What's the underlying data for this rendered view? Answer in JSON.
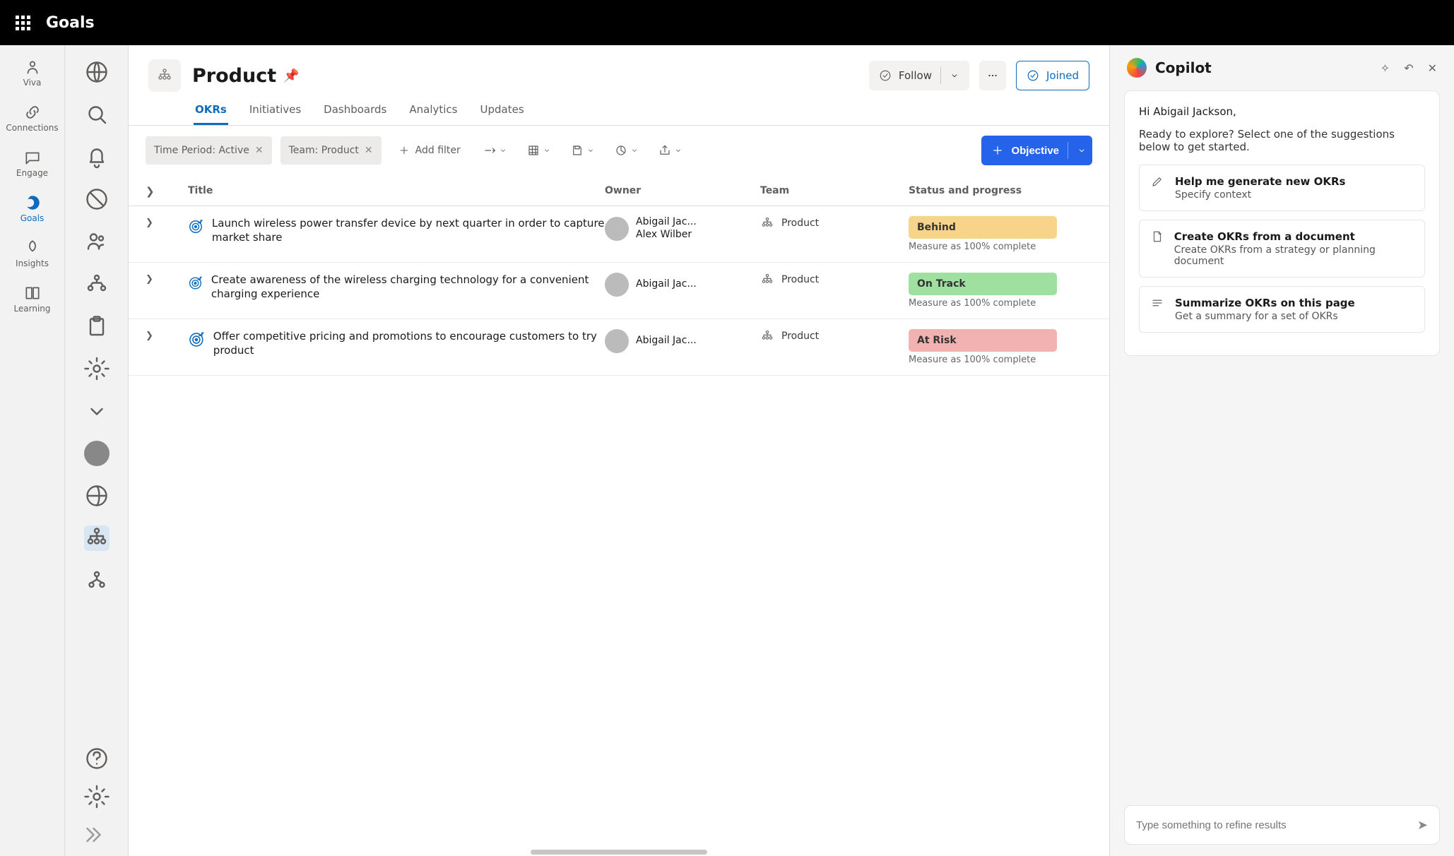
{
  "topbar": {
    "title": "Goals"
  },
  "appRail": [
    {
      "id": "viva",
      "label": "Viva"
    },
    {
      "id": "connections",
      "label": "Connections"
    },
    {
      "id": "engage",
      "label": "Engage"
    },
    {
      "id": "goals",
      "label": "Goals",
      "active": true
    },
    {
      "id": "insights",
      "label": "Insights"
    },
    {
      "id": "learning",
      "label": "Learning"
    }
  ],
  "page": {
    "title": "Product",
    "tabs": [
      "OKRs",
      "Initiatives",
      "Dashboards",
      "Analytics",
      "Updates"
    ],
    "follow": "Follow",
    "joined": "Joined"
  },
  "filters": {
    "timePeriod": "Time Period: Active",
    "team": "Team:  Product",
    "addFilter": "Add filter",
    "objectiveBtn": "Objective"
  },
  "columns": {
    "title": "Title",
    "owner": "Owner",
    "team": "Team",
    "status": "Status and progress"
  },
  "okrs": [
    {
      "title": "Launch wireless power transfer device by next quarter in order to capture market share",
      "owners": [
        "Abigail Jac...",
        "Alex Wilber"
      ],
      "team": "Product",
      "status": {
        "label": "Behind",
        "class": "behind"
      },
      "measure": "Measure as 100% complete"
    },
    {
      "title": "Create awareness of the wireless charging technology for a convenient charging experience",
      "owners": [
        "Abigail Jac..."
      ],
      "team": "Product",
      "status": {
        "label": "On Track",
        "class": "ontrack"
      },
      "measure": "Measure as 100% complete"
    },
    {
      "title": "Offer competitive pricing and promotions to encourage customers to try product",
      "owners": [
        "Abigail Jac..."
      ],
      "team": "Product",
      "status": {
        "label": "At Risk",
        "class": "risk"
      },
      "measure": "Measure as 100% complete"
    }
  ],
  "copilot": {
    "title": "Copilot",
    "greet": "Hi Abigail Jackson,",
    "intro": "Ready to explore? Select one of the suggestions below to get started.",
    "suggestions": [
      {
        "title": "Help me generate new OKRs",
        "sub": "Specify context",
        "icon": "pencil"
      },
      {
        "title": "Create OKRs from a document",
        "sub": "Create OKRs from a strategy or planning document",
        "icon": "doc"
      },
      {
        "title": "Summarize OKRs on this page",
        "sub": "Get a summary for a set of OKRs",
        "icon": "lines"
      }
    ],
    "placeholder": "Type something to refine results"
  }
}
